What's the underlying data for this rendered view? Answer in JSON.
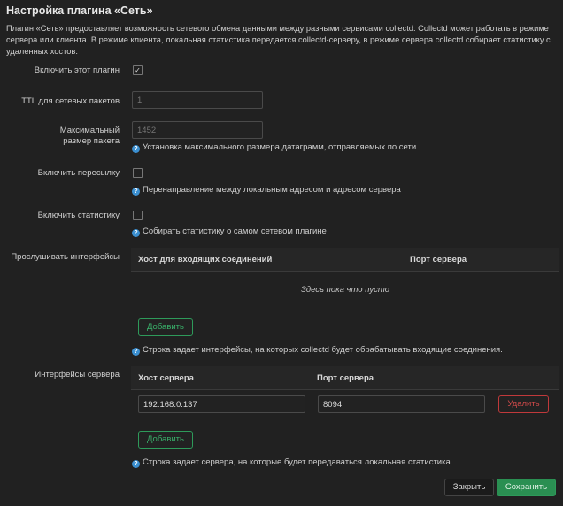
{
  "title": "Настройка плагина «Сеть»",
  "description": "Плагин «Сеть» предоставляет возможность сетевого обмена данными между разными сервисами collectd. Collectd может работать в режиме сервера или клиента. В режиме клиента, локальная статистика передается collectd-серверу, в режиме сервера collectd собирает статистику с удаленных хостов.",
  "fields": {
    "enable": {
      "label": "Включить этот плагин",
      "checked": true
    },
    "ttl": {
      "label": "TTL для сетевых пакетов",
      "placeholder": "1"
    },
    "maxsize": {
      "label": "Максимальный размер пакета",
      "placeholder": "1452",
      "help": "Установка максимального размера датаграмм, отправляемых по сети"
    },
    "forward": {
      "label": "Включить пересылку",
      "checked": false,
      "help": "Перенаправление между локальным адресом и адресом сервера"
    },
    "stats": {
      "label": "Включить статистику",
      "checked": false,
      "help": "Собирать статистику о самом сетевом плагине"
    }
  },
  "listen": {
    "label": "Прослушивать интерфейсы",
    "columns": [
      "Хост для входящих соединений",
      "Порт сервера"
    ],
    "empty": "Здесь пока что пусто",
    "add": "Добавить",
    "help": "Строка задает интерфейсы, на которых collectd будет обрабатывать входящие соединения."
  },
  "servers": {
    "label": "Интерфейсы сервера",
    "columns": [
      "Хост сервера",
      "Порт сервера"
    ],
    "rows": [
      {
        "host": "192.168.0.137",
        "port": "8094",
        "delete": "Удалить"
      }
    ],
    "add": "Добавить",
    "help": "Строка задает сервера, на которые будет передаваться локальная статистика."
  },
  "footer": {
    "close": "Закрыть",
    "save": "Сохранить"
  },
  "colors": {
    "accent": "#2e9a5a",
    "danger": "#c0393b",
    "help_icon": "#3b8fd0"
  }
}
